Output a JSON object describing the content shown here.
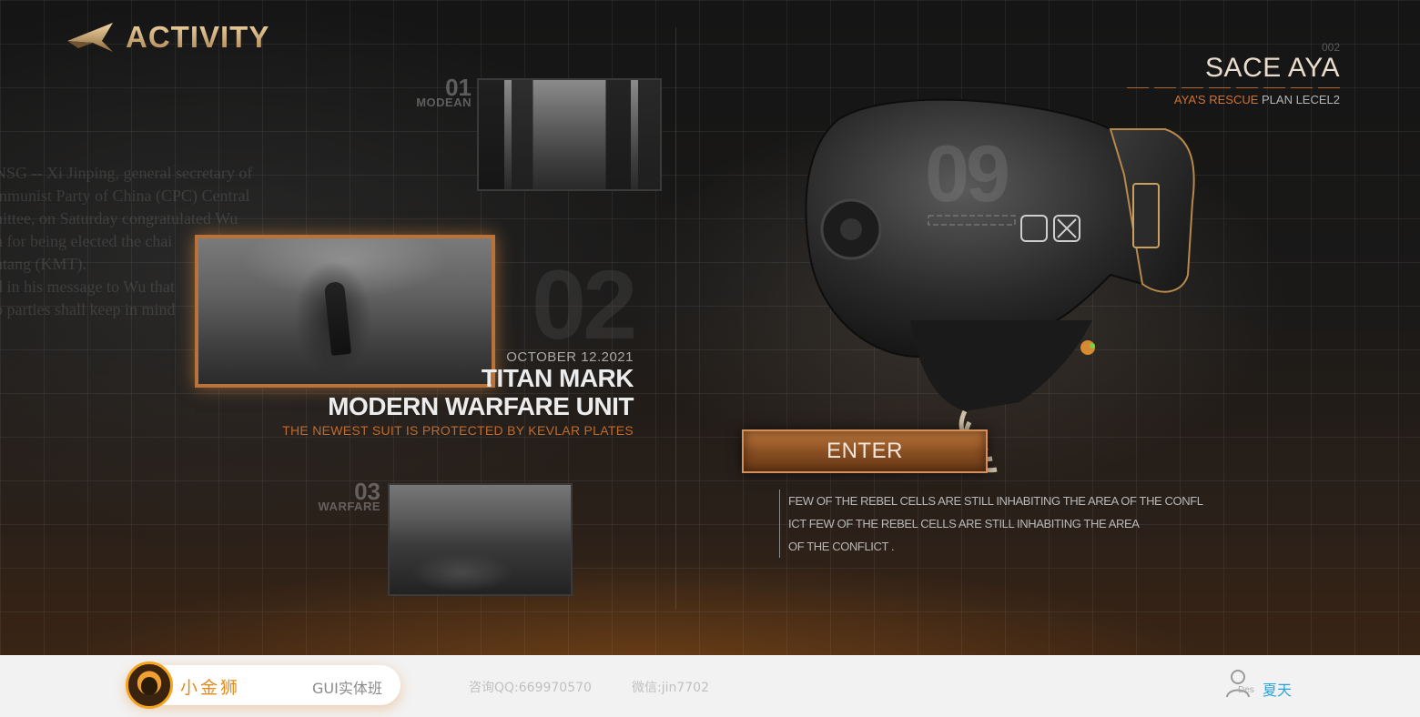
{
  "header": {
    "title": "ACTIVITY",
    "logo_icon": "wing-arrow-icon"
  },
  "background": {
    "news_lines": [
      "NSG -- Xi Jinping, general secretary of",
      "mmunist Party of China (CPC) Central",
      "nittee, on Saturday congratulated Wu",
      "h for being elected the chai",
      "ntang (KMT).",
      "d in his message to Wu that",
      "o parties shall keep in mind"
    ]
  },
  "gallery": {
    "items": [
      {
        "number": "01",
        "label": "MODEAN"
      },
      {
        "number": "02",
        "label": ""
      },
      {
        "number": "03",
        "label": "WARFARE"
      }
    ],
    "featured": {
      "big_number": "02",
      "date": "OCTOBER 12.2021",
      "title_line1": "TITAN MARK",
      "title_line2": "MODERN WARFARE UNIT",
      "subtitle": "THE NEWEST SUIT IS PROTECTED BY KEVLAR PLATES"
    }
  },
  "character": {
    "code": "002",
    "name": "SACE AYA",
    "plan_highlight": "AYA’S RESCUE",
    "plan_rest": " PLAN  LECEL2",
    "helmet_number": "09",
    "enter_label": "ENTER",
    "description_lines": [
      "FEW OF THE REBEL CELLS ARE STILL INHABITING THE AREA OF THE CONFL",
      "ICT FEW OF THE REBEL CELLS ARE STILL INHABITING THE AREA",
      "OF THE CONFLICT ."
    ]
  },
  "footer": {
    "brand_name": "小金狮",
    "course": "GUI实体班",
    "qq": "咨询QQ:669970570",
    "wechat": "微信:jin7702",
    "user_badge": "Des",
    "user_name": "夏天"
  },
  "colors": {
    "accent": "#c06a2c",
    "gold": "#e8dccc",
    "footer_bg": "#f2f2f2",
    "brand_orange": "#e58a1a",
    "user_blue": "#2aa3dd"
  }
}
